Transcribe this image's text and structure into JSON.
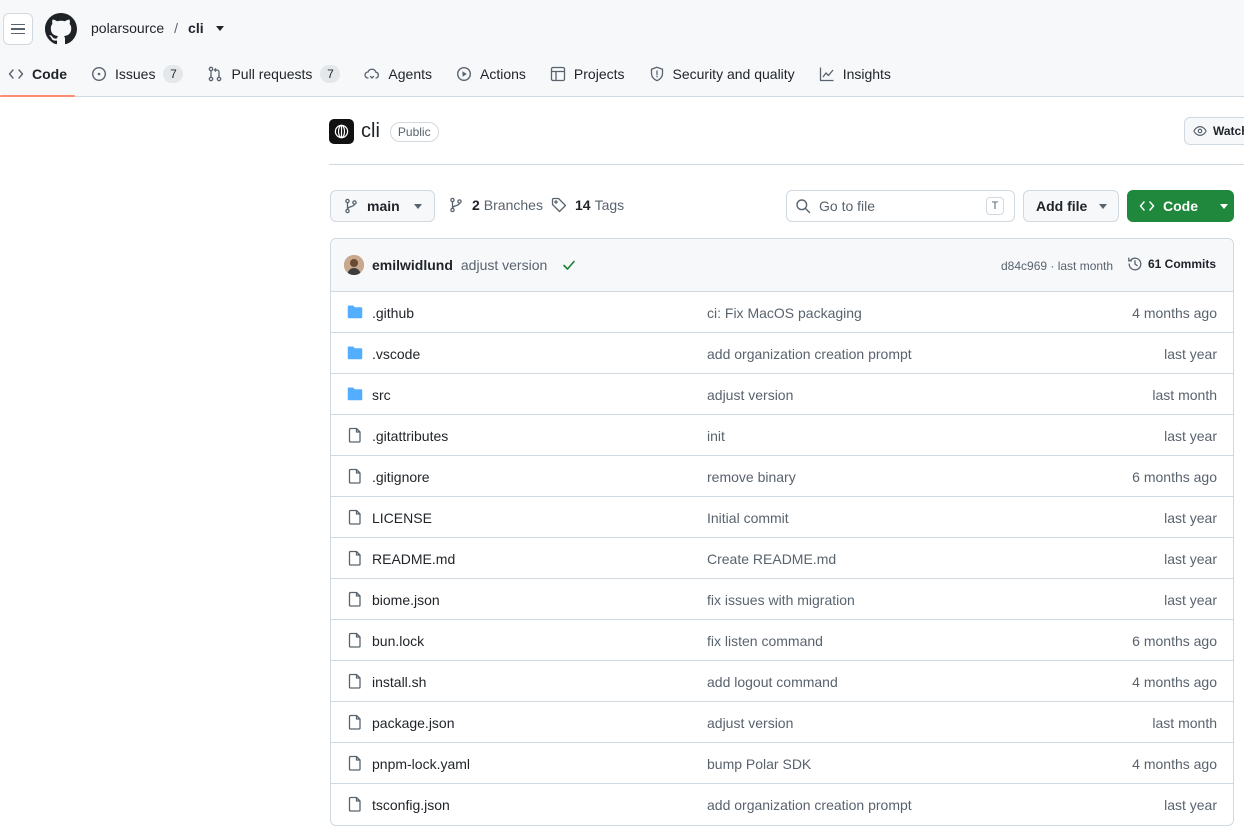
{
  "header": {
    "owner": "polarsource",
    "separator": "/",
    "repo": "cli"
  },
  "tabs": [
    {
      "label": "Code",
      "icon": "code-icon"
    },
    {
      "label": "Issues",
      "count": "7",
      "icon": "issue-icon"
    },
    {
      "label": "Pull requests",
      "count": "7",
      "icon": "pull-request-icon"
    },
    {
      "label": "Agents",
      "icon": "agents-icon"
    },
    {
      "label": "Actions",
      "icon": "play-icon"
    },
    {
      "label": "Projects",
      "icon": "table-icon"
    },
    {
      "label": "Security and quality",
      "icon": "shield-icon"
    },
    {
      "label": "Insights",
      "icon": "graph-icon"
    }
  ],
  "repo": {
    "name": "cli",
    "visibility": "Public",
    "watch_label": "Watch"
  },
  "toolbar": {
    "branch": "main",
    "branches_count": "2",
    "branches_label": "Branches",
    "tags_count": "14",
    "tags_label": "Tags",
    "search_placeholder": "Go to file",
    "search_shortcut": "T",
    "add_file_label": "Add file",
    "code_label": "Code"
  },
  "latest_commit": {
    "author": "emilwidlund",
    "message": "adjust version",
    "meta": "d84c969 · last month",
    "commits_label": "61 Commits"
  },
  "files": [
    {
      "type": "folder",
      "name": ".github",
      "message": "ci: Fix MacOS packaging",
      "date": "4 months ago"
    },
    {
      "type": "folder",
      "name": ".vscode",
      "message": "add organization creation prompt",
      "date": "last year"
    },
    {
      "type": "folder",
      "name": "src",
      "message": "adjust version",
      "date": "last month"
    },
    {
      "type": "file",
      "name": ".gitattributes",
      "message": "init",
      "date": "last year"
    },
    {
      "type": "file",
      "name": ".gitignore",
      "message": "remove binary",
      "date": "6 months ago"
    },
    {
      "type": "file",
      "name": "LICENSE",
      "message": "Initial commit",
      "date": "last year"
    },
    {
      "type": "file",
      "name": "README.md",
      "message": "Create README.md",
      "date": "last year"
    },
    {
      "type": "file",
      "name": "biome.json",
      "message": "fix issues with migration",
      "date": "last year"
    },
    {
      "type": "file",
      "name": "bun.lock",
      "message": "fix listen command",
      "date": "6 months ago"
    },
    {
      "type": "file",
      "name": "install.sh",
      "message": "add logout command",
      "date": "4 months ago"
    },
    {
      "type": "file",
      "name": "package.json",
      "message": "adjust version",
      "date": "last month"
    },
    {
      "type": "file",
      "name": "pnpm-lock.yaml",
      "message": "bump Polar SDK",
      "date": "4 months ago"
    },
    {
      "type": "file",
      "name": "tsconfig.json",
      "message": "add organization creation prompt",
      "date": "last year"
    }
  ],
  "colors": {
    "accent_underline": "#fd8c73",
    "folder": "#54aeff",
    "primary_button": "#1f883d",
    "check": "#1a7f37"
  }
}
